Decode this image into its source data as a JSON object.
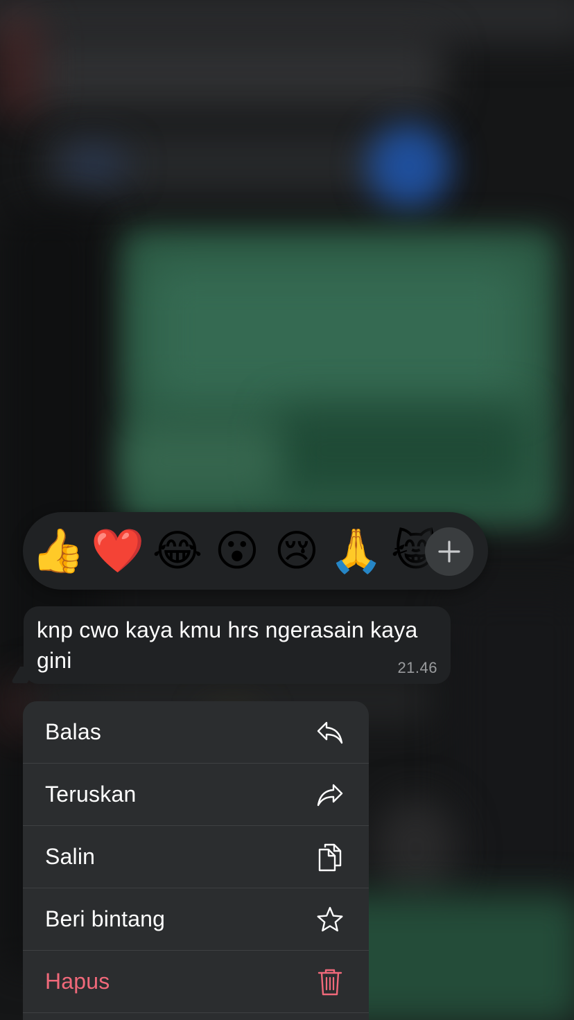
{
  "reactions": [
    {
      "emoji": "👍",
      "name": "thumbs-up"
    },
    {
      "emoji": "❤️",
      "name": "heart"
    },
    {
      "emoji": "😂",
      "name": "tears-of-joy"
    },
    {
      "emoji": "😮",
      "name": "surprised"
    },
    {
      "emoji": "😢",
      "name": "crying"
    },
    {
      "emoji": "🙏",
      "name": "folded-hands"
    },
    {
      "emoji": "😹",
      "name": "cat-tears-of-joy"
    }
  ],
  "message": {
    "text": "knp cwo kaya kmu hrs ngerasain kaya gini",
    "time": "21.46"
  },
  "menu": {
    "items": [
      {
        "label": "Balas",
        "icon": "reply-icon"
      },
      {
        "label": "Teruskan",
        "icon": "forward-icon"
      },
      {
        "label": "Salin",
        "icon": "copy-icon"
      },
      {
        "label": "Beri bintang",
        "icon": "star-icon"
      },
      {
        "label": "Hapus",
        "icon": "trash-icon"
      }
    ]
  },
  "colors": {
    "panel": "#202224",
    "menu": "#2b2d2f",
    "danger": "#f0697a",
    "timestamp": "#9a9c9e"
  }
}
